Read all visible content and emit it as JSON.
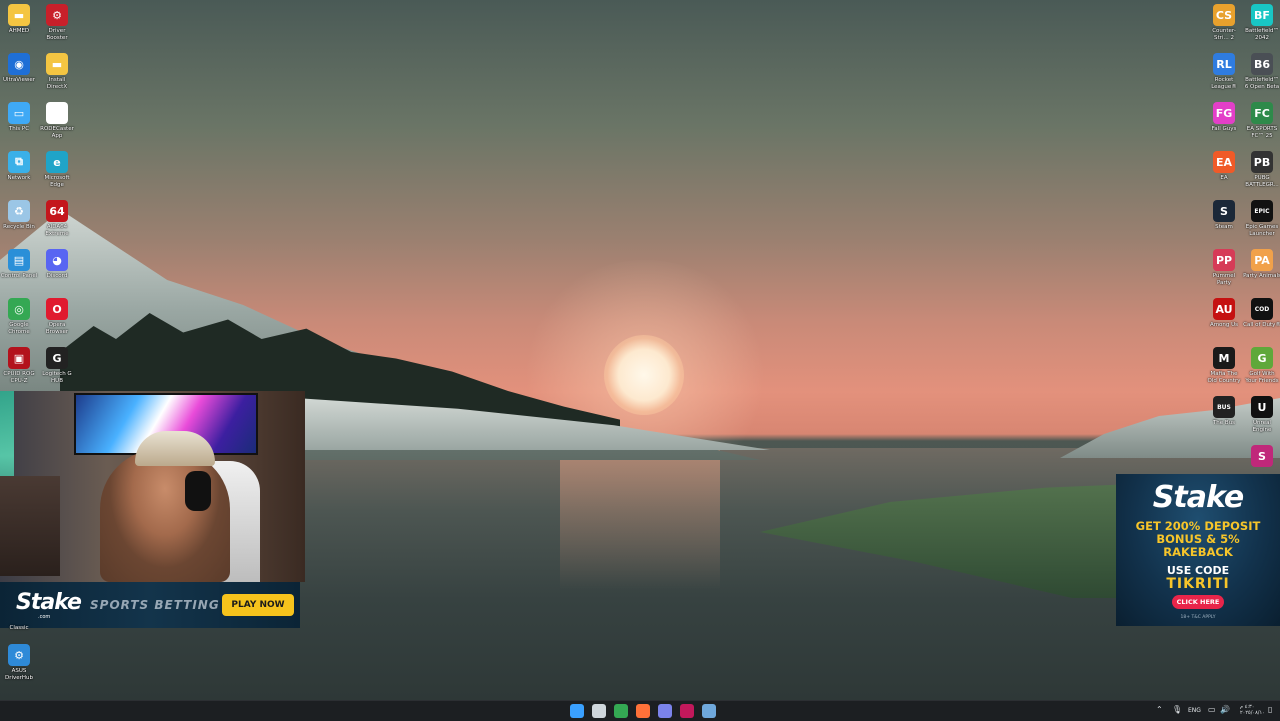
{
  "desktop": {
    "left_icons": [
      {
        "name": "folder-icon",
        "label": "AHMED",
        "color": "#f4c542",
        "glyph": "▬",
        "col": 0,
        "row": 0
      },
      {
        "name": "driver-booster-icon",
        "label": "Driver Booster",
        "color": "#c8202a",
        "glyph": "⚙",
        "col": 1,
        "row": 0
      },
      {
        "name": "ultraviewer-icon",
        "label": "UltraViewer",
        "color": "#1f6fd6",
        "glyph": "◉",
        "col": 0,
        "row": 1
      },
      {
        "name": "folder-icon",
        "label": "Install DirectX",
        "color": "#f4c542",
        "glyph": "▬",
        "col": 1,
        "row": 1
      },
      {
        "name": "this-pc-icon",
        "label": "This PC",
        "color": "#3fa9f5",
        "glyph": "▭",
        "col": 0,
        "row": 2
      },
      {
        "name": "rodecaster-icon",
        "label": "RODECaster App",
        "color": "#ffffff",
        "glyph": "◼",
        "col": 1,
        "row": 2
      },
      {
        "name": "network-icon",
        "label": "Network",
        "color": "#3ab0e8",
        "glyph": "⧉",
        "col": 0,
        "row": 3
      },
      {
        "name": "edge-icon",
        "label": "Microsoft Edge",
        "color": "#1fa4c8",
        "glyph": "e",
        "col": 1,
        "row": 3
      },
      {
        "name": "recycle-bin-icon",
        "label": "Recycle Bin",
        "color": "#9bc6e6",
        "glyph": "♻",
        "col": 0,
        "row": 4
      },
      {
        "name": "aida64-icon",
        "label": "AIDA64 Extreme",
        "color": "#c4161c",
        "glyph": "64",
        "col": 1,
        "row": 4
      },
      {
        "name": "control-panel-icon",
        "label": "Control Panel",
        "color": "#2a8fd8",
        "glyph": "▤",
        "col": 0,
        "row": 5
      },
      {
        "name": "discord-icon",
        "label": "Discord",
        "color": "#5865f2",
        "glyph": "◕",
        "col": 1,
        "row": 5
      },
      {
        "name": "chrome-icon",
        "label": "Google Chrome",
        "color": "#34a853",
        "glyph": "◎",
        "col": 0,
        "row": 6
      },
      {
        "name": "opera-icon",
        "label": "Opera Browser",
        "color": "#e01a2f",
        "glyph": "O",
        "col": 1,
        "row": 6
      },
      {
        "name": "cpuz-icon",
        "label": "CPUID ROG CPU-Z",
        "color": "#b3121c",
        "glyph": "▣",
        "col": 0,
        "row": 7
      },
      {
        "name": "logitech-icon",
        "label": "Logitech G HUB",
        "color": "#222222",
        "glyph": "G",
        "col": 1,
        "row": 7
      }
    ],
    "left_bottom_icons": [
      {
        "name": "classic-label",
        "label": "Classic"
      },
      {
        "name": "asus-driverhub-icon",
        "label": "ASUS DriverHub",
        "color": "#2e8ad8",
        "glyph": "⚙"
      }
    ],
    "right_icons": [
      {
        "name": "counter-strike-icon",
        "label": "Counter-Stri... 2",
        "color": "#e8a12d",
        "glyph": "CS",
        "col": 0,
        "row": 0
      },
      {
        "name": "battlefield-2042-icon",
        "label": "Battlefield™ 2042",
        "color": "#19c6c4",
        "glyph": "BF",
        "col": 1,
        "row": 0
      },
      {
        "name": "rocket-league-icon",
        "label": "Rocket League®",
        "color": "#2f7ce0",
        "glyph": "RL",
        "col": 0,
        "row": 1
      },
      {
        "name": "battlefield-6-icon",
        "label": "Battlefield™ 6 Open Beta",
        "color": "#4a4f55",
        "glyph": "B6",
        "col": 1,
        "row": 1
      },
      {
        "name": "fall-guys-icon",
        "label": "Fall Guys",
        "color": "#e33fc8",
        "glyph": "FG",
        "col": 0,
        "row": 2
      },
      {
        "name": "ea-sports-fc-icon",
        "label": "EA SPORTS FC™ 25",
        "color": "#2e8a4a",
        "glyph": "FC",
        "col": 1,
        "row": 2
      },
      {
        "name": "ea-icon",
        "label": "EA",
        "color": "#f05a28",
        "glyph": "EA",
        "col": 0,
        "row": 3
      },
      {
        "name": "pubg-icon",
        "label": "PUBG BATTLEGR...",
        "color": "#333333",
        "glyph": "PB",
        "col": 1,
        "row": 3
      },
      {
        "name": "steam-icon",
        "label": "Steam",
        "color": "#1b2838",
        "glyph": "S",
        "col": 0,
        "row": 4
      },
      {
        "name": "epic-games-icon",
        "label": "Epic Games Launcher",
        "color": "#111111",
        "glyph": "EPIC",
        "col": 1,
        "row": 4
      },
      {
        "name": "pummel-party-icon",
        "label": "Pummel Party",
        "color": "#d63b57",
        "glyph": "PP",
        "col": 0,
        "row": 5
      },
      {
        "name": "party-animals-icon",
        "label": "Party Animals",
        "color": "#f1a14a",
        "glyph": "PA",
        "col": 1,
        "row": 5
      },
      {
        "name": "among-us-icon",
        "label": "Among Us",
        "color": "#c51111",
        "glyph": "AU",
        "col": 0,
        "row": 6
      },
      {
        "name": "call-of-duty-icon",
        "label": "Call of Duty®",
        "color": "#111111",
        "glyph": "COD",
        "col": 1,
        "row": 6
      },
      {
        "name": "mafia-icon",
        "label": "Mafia The Old Country",
        "color": "#1a1a1a",
        "glyph": "M",
        "col": 0,
        "row": 7
      },
      {
        "name": "golf-with-friends-icon",
        "label": "Golf With Your Friends",
        "color": "#5fa83a",
        "glyph": "G",
        "col": 1,
        "row": 7
      },
      {
        "name": "the-bus-icon",
        "label": "The Bus",
        "color": "#222222",
        "glyph": "BUS",
        "col": 0,
        "row": 8
      },
      {
        "name": "unreal-engine-icon",
        "label": "Unreal Engine",
        "color": "#101010",
        "glyph": "U",
        "col": 1,
        "row": 8
      },
      {
        "name": "app-icon",
        "label": "",
        "color": "#c0287a",
        "glyph": "S",
        "col": 1,
        "row": 9
      }
    ]
  },
  "overlay": {
    "stake_bar": {
      "logo": "Stake",
      "logo_sub": ".com",
      "ticker": "SPORTS BETTING",
      "play_label": "PLAY NOW"
    },
    "ad": {
      "logo": "Stake",
      "line1": "GET 200% DEPOSIT",
      "line2": "BONUS & 5%",
      "line3": "RAKEBACK",
      "code_label": "USE CODE",
      "code": "TIKRITI",
      "click_label": "CLICK HERE",
      "tiny": "18+ T&C APPLY"
    }
  },
  "taskbar": {
    "apps": [
      {
        "name": "start-icon",
        "color": "#3aa0ff"
      },
      {
        "name": "task-view-icon",
        "color": "#cfd6dc"
      },
      {
        "name": "chrome-icon",
        "color": "#34a853"
      },
      {
        "name": "firefox-icon",
        "color": "#ff7139"
      },
      {
        "name": "teams-icon",
        "color": "#7b83eb"
      },
      {
        "name": "obs-icon",
        "color": "#c2185b"
      },
      {
        "name": "steam-icon",
        "color": "#6fa8dc"
      }
    ],
    "tray": {
      "language": "ENG",
      "time": "٤:٣٠ م",
      "date": "٢٠٢٥/٠٨/١٠"
    }
  }
}
